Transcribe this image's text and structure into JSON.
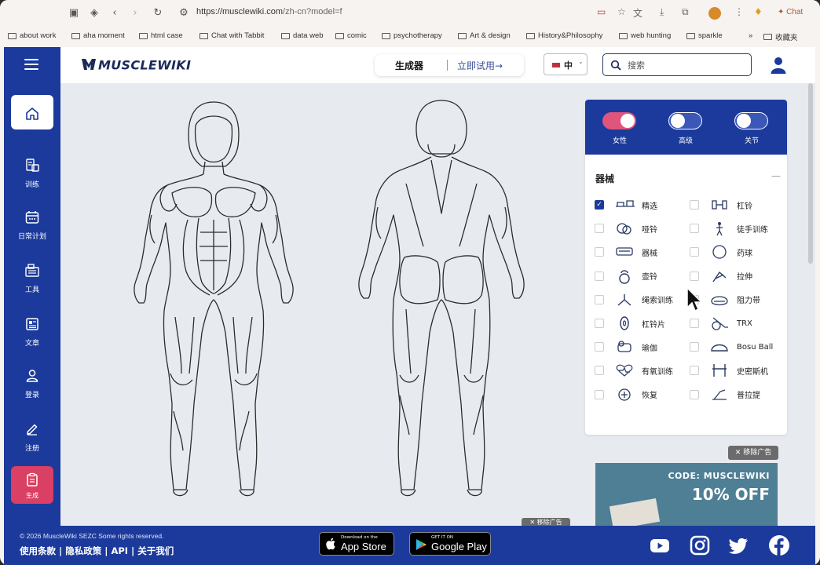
{
  "browser": {
    "url_host": "https://musclewiki.com",
    "url_path": "/zh-cn?model=f",
    "chat_label": "Chat",
    "bookmarks": [
      "about work",
      "aha moment",
      "html case",
      "Chat with Tabbit",
      "data web",
      "comic",
      "psychotherapy",
      "Art & design",
      "History&Philosophy",
      "web hunting",
      "sparkle",
      "收藏夹"
    ],
    "overflow": "»"
  },
  "sidebar": {
    "items": [
      {
        "label": "首页",
        "icon": "home-icon"
      },
      {
        "label": "训练",
        "icon": "training-icon"
      },
      {
        "label": "日常计划",
        "icon": "calendar-icon"
      },
      {
        "label": "工具",
        "icon": "tools-icon"
      },
      {
        "label": "文章",
        "icon": "article-icon"
      },
      {
        "label": "登录",
        "icon": "user-icon"
      },
      {
        "label": "注册",
        "icon": "edit-icon"
      },
      {
        "label": "生成",
        "icon": "clipboard-icon"
      }
    ]
  },
  "header": {
    "logo": "MUSCLEWIKI",
    "generator": "生成器",
    "try_now": "立即试用→",
    "lang": "中",
    "search_placeholder": "搜索"
  },
  "panel": {
    "toggles": [
      {
        "label": "女性",
        "on": true
      },
      {
        "label": "高级",
        "on": false
      },
      {
        "label": "关节",
        "on": false
      }
    ],
    "equipment_title": "器械",
    "collapse": "—",
    "left_items": [
      {
        "label": "精选",
        "checked": true,
        "icon": "featured-icon"
      },
      {
        "label": "哑铃",
        "checked": false,
        "icon": "dumbbell-icon"
      },
      {
        "label": "器械",
        "checked": false,
        "icon": "machine-icon"
      },
      {
        "label": "壶铃",
        "checked": false,
        "icon": "kettlebell-icon"
      },
      {
        "label": "绳索训练",
        "checked": false,
        "icon": "cable-icon"
      },
      {
        "label": "杠铃片",
        "checked": false,
        "icon": "plate-icon"
      },
      {
        "label": "瑜伽",
        "checked": false,
        "icon": "yoga-icon"
      },
      {
        "label": "有氧训练",
        "checked": false,
        "icon": "cardio-icon"
      },
      {
        "label": "恢复",
        "checked": false,
        "icon": "recovery-icon"
      }
    ],
    "right_items": [
      {
        "label": "杠铃",
        "checked": false,
        "icon": "barbell-icon"
      },
      {
        "label": "徒手训练",
        "checked": false,
        "icon": "bodyweight-icon"
      },
      {
        "label": "药球",
        "checked": false,
        "icon": "medicine-ball-icon"
      },
      {
        "label": "拉伸",
        "checked": false,
        "icon": "stretch-icon"
      },
      {
        "label": "阻力带",
        "checked": false,
        "icon": "band-icon"
      },
      {
        "label": "TRX",
        "checked": false,
        "icon": "trx-icon"
      },
      {
        "label": "Bosu Ball",
        "checked": false,
        "icon": "bosu-icon"
      },
      {
        "label": "史密斯机",
        "checked": false,
        "icon": "smith-machine-icon"
      },
      {
        "label": "普拉提",
        "checked": false,
        "icon": "pilates-icon"
      }
    ]
  },
  "ad": {
    "remove": "✕ 移除广告",
    "code": "CODE: MUSCLEWIKI",
    "offer": "10% OFF",
    "remove_small": "✕ 移除广告"
  },
  "footer": {
    "copyright": "© 2026 MuscleWiki SEZC Some rights reserved.",
    "links": [
      "使用条款",
      "隐私政策",
      "API",
      "关于我们"
    ],
    "app_store_small": "Download on the",
    "app_store": "App Store",
    "google_small": "GET IT ON",
    "google": "Google Play"
  },
  "colors": {
    "brand_blue": "#1b3a9b",
    "accent_pink": "#d94063",
    "toggle_on": "#e0557c",
    "page_bg": "#e7ebf0"
  }
}
